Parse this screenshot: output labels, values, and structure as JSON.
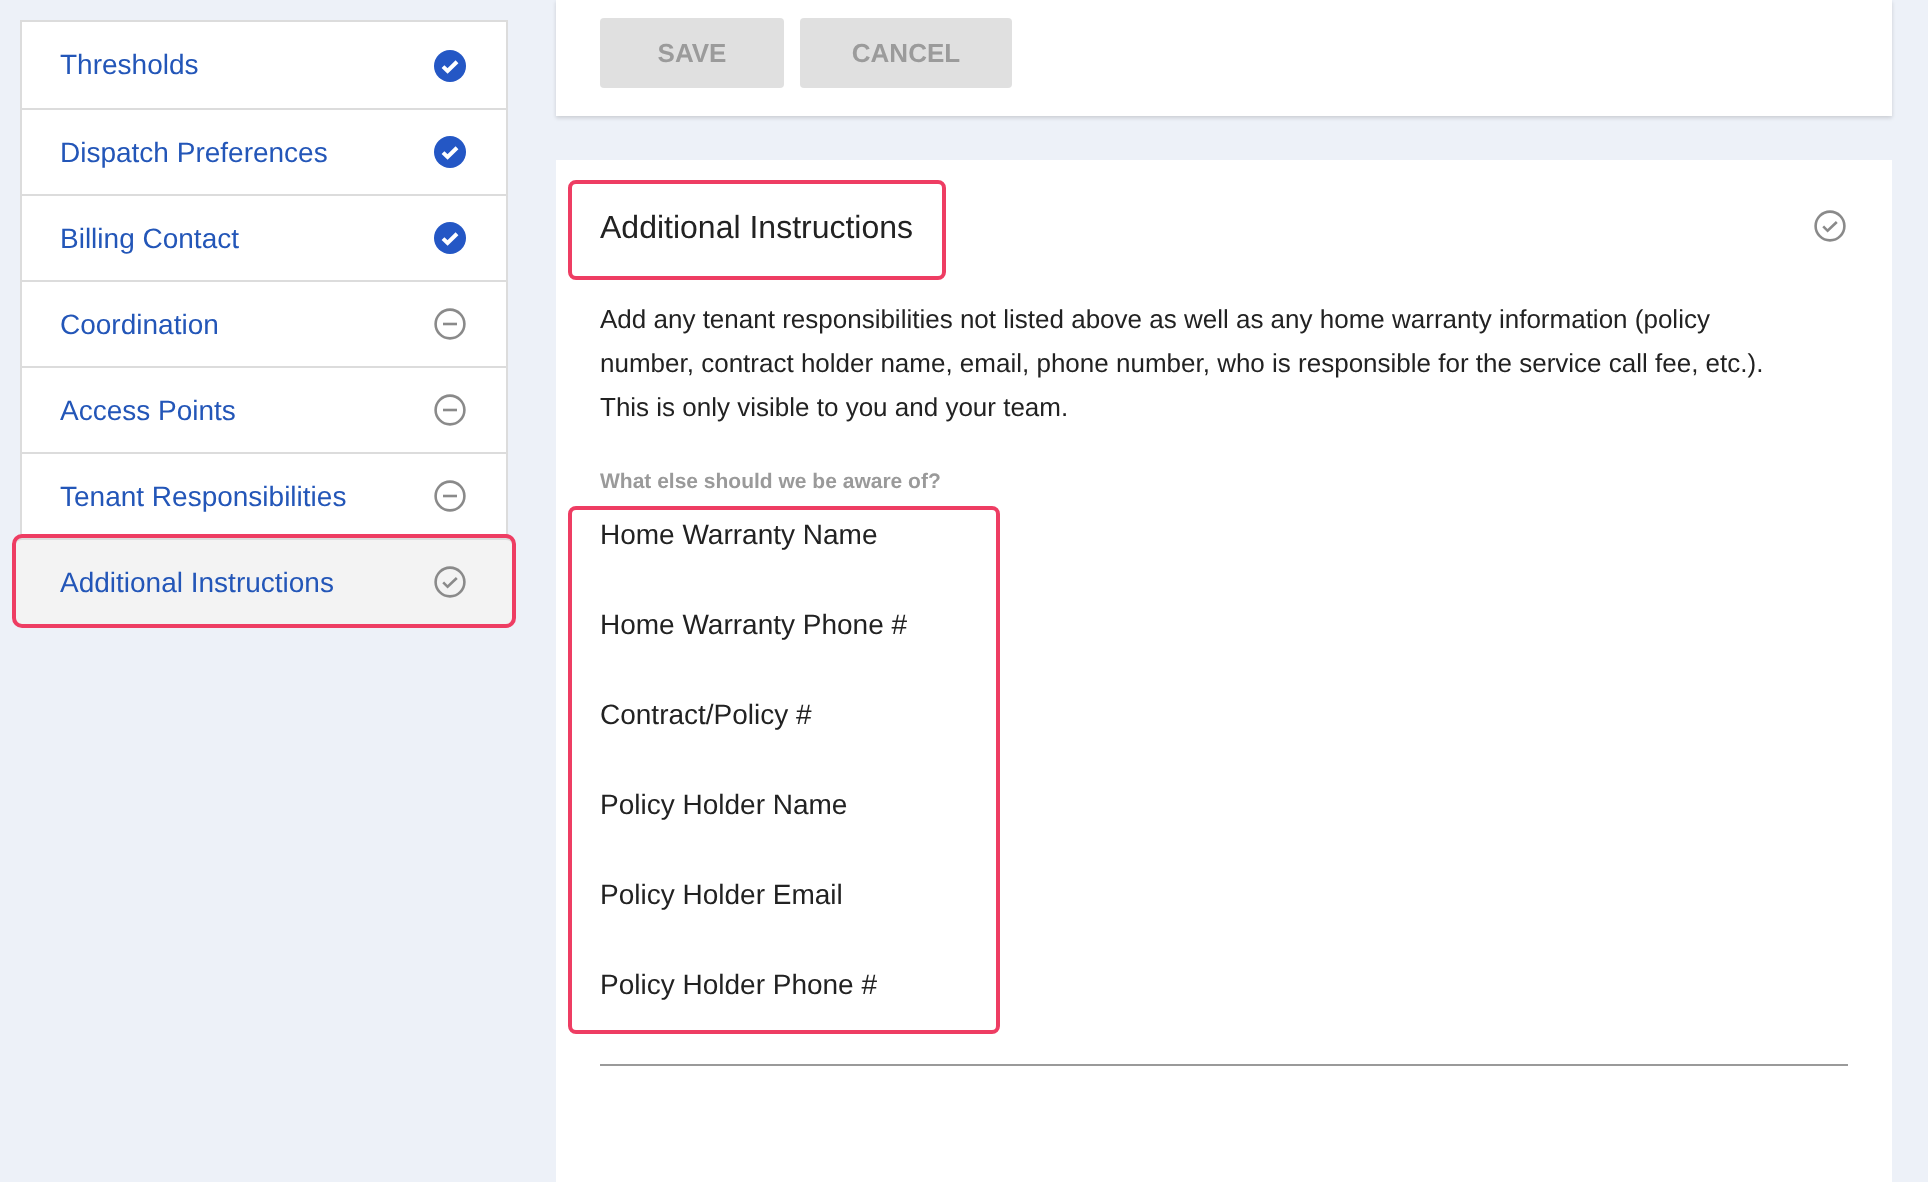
{
  "sidebar": {
    "items": [
      {
        "label": "Thresholds",
        "kind": "complete",
        "selected": false
      },
      {
        "label": "Dispatch Preferences",
        "kind": "complete",
        "selected": false
      },
      {
        "label": "Billing Contact",
        "kind": "complete",
        "selected": false
      },
      {
        "label": "Coordination",
        "kind": "empty",
        "selected": false
      },
      {
        "label": "Access Points",
        "kind": "empty",
        "selected": false
      },
      {
        "label": "Tenant Responsibilities",
        "kind": "empty",
        "selected": false
      },
      {
        "label": "Additional Instructions",
        "kind": "outline",
        "selected": true
      }
    ]
  },
  "actions": [
    {
      "label": "SAVE",
      "disabled": true
    },
    {
      "label": "CANCEL",
      "disabled": true
    }
  ],
  "section": {
    "title": "Additional Instructions",
    "kind": "outline",
    "description": [
      "Add any tenant responsibilities not listed above as well as any home warranty information (policy number, contract holder name, email, phone number, who is responsible for the service call fee, etc.).",
      "This is only visible to you and your team."
    ],
    "field": {
      "label": "What else should we be aware of?",
      "lines": [
        "Home Warranty Name",
        "Home Warranty Phone #",
        "Contract/Policy #",
        "Policy Holder Name",
        "Policy Holder Email",
        "Policy Holder Phone #"
      ]
    }
  }
}
